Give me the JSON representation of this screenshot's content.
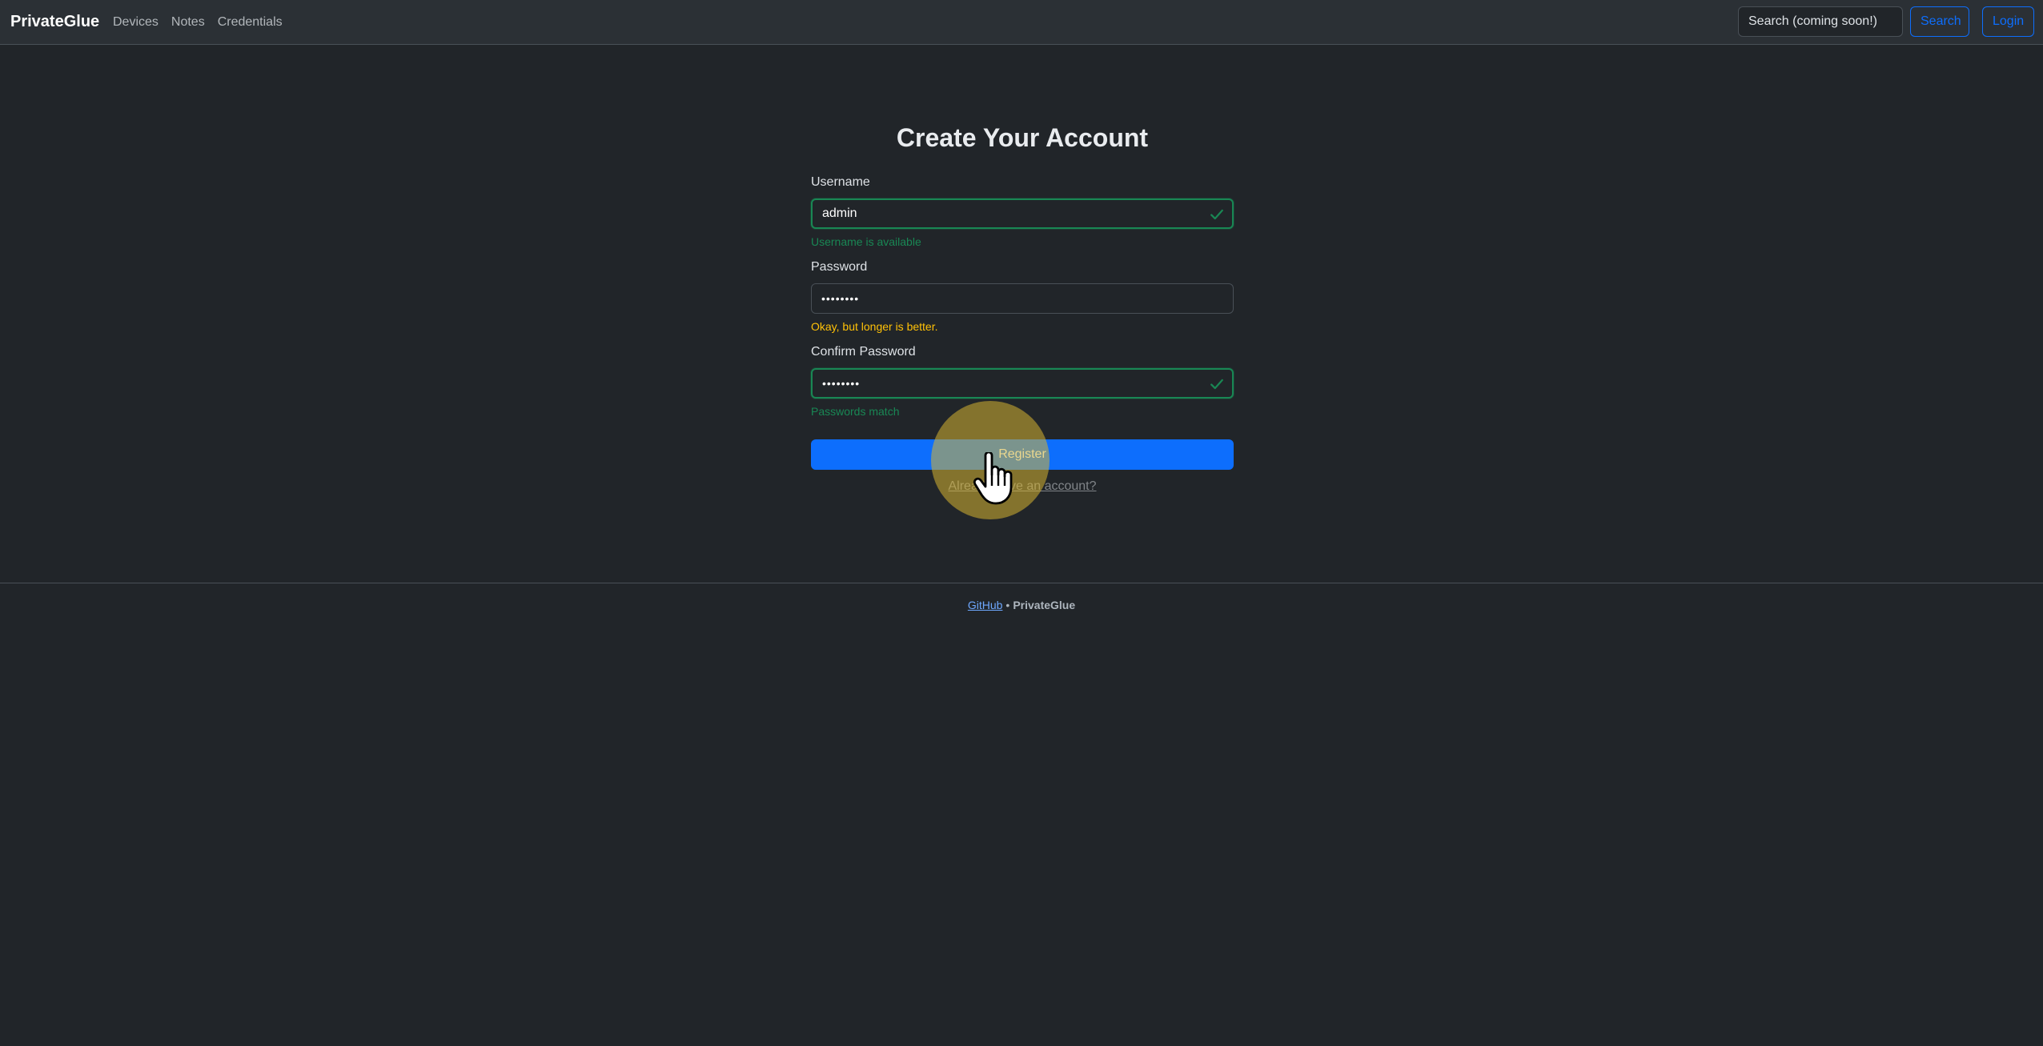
{
  "navbar": {
    "brand": "PrivateGlue",
    "links": [
      "Devices",
      "Notes",
      "Credentials"
    ],
    "search_placeholder": "Search (coming soon!)",
    "search_button": "Search",
    "login_button": "Login"
  },
  "form": {
    "title": "Create Your Account",
    "username": {
      "label": "Username",
      "value": "admin",
      "feedback": "Username is available"
    },
    "password": {
      "label": "Password",
      "value": "••••••••",
      "feedback": "Okay, but longer is better."
    },
    "confirm_password": {
      "label": "Confirm Password",
      "value": "••••••••",
      "feedback": "Passwords match"
    },
    "submit_label": "Register",
    "login_link": "Already have an account?"
  },
  "footer": {
    "link": "GitHub",
    "separator": "•",
    "app_name": "PrivateGlue"
  },
  "colors": {
    "background": "#212529",
    "navbar": "#2b3035",
    "primary": "#0d6efd",
    "success": "#198754",
    "warning": "#ffc107"
  }
}
